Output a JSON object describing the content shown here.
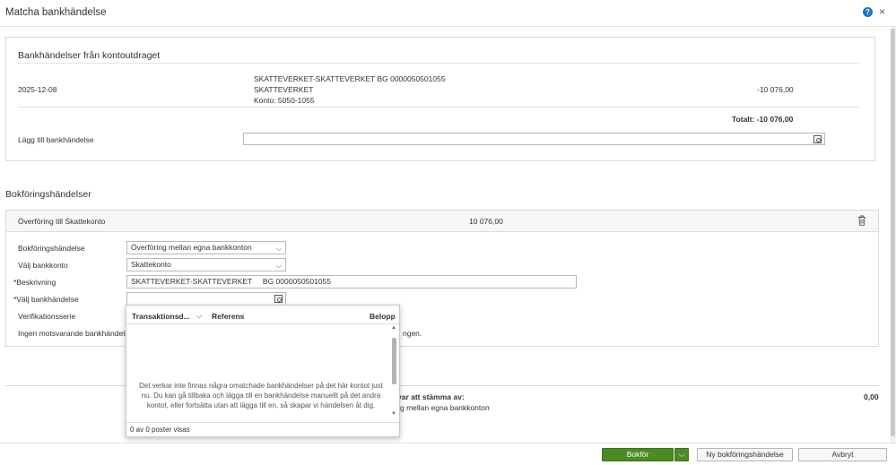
{
  "dialog": {
    "title": "Matcha bankhändelse",
    "help_glyph": "?",
    "close_glyph": "×"
  },
  "bank_events": {
    "heading": "Bankhändelser från kontoutdraget",
    "date": "2025-12-08",
    "desc_line1": "SKATTEVERKET-SKATTEVERKET BG 0000050501055",
    "desc_line2": "SKATTEVERKET",
    "desc_line3": "Konto: 5050-1055",
    "amount": "-10 076,00",
    "total": "Totalt: -10 076,00",
    "add_label": "Lägg till bankhändelse"
  },
  "booking": {
    "section_title": "Bokföringshändelser",
    "row_title": "Överföring till Skattekonto",
    "row_amount": "10 076,00",
    "fields": {
      "event_label": "Bokföringshändelse",
      "event_value": "Överföring mellan egna bankkonton",
      "account_label": "Välj bankkonto",
      "account_value": "Skattekonto",
      "description_label": "Beskrivning",
      "description_value": "SKATTEVERKET-SKATTEVERKET     BG 0000050501055",
      "bank_event_label": "Välj bankhändelse",
      "series_label": "Verifikationsserie",
      "no_match_prefix": "Ingen motsvarande bankhändels",
      "no_match_suffix": "ngen."
    },
    "required_marker": "*"
  },
  "dropdown": {
    "col_date": "Transaktionsd...",
    "col_ref": "Referens",
    "col_amount": "Belopp",
    "empty_text": "Det verkar inte finnas några omatchade bankhändelser på det här kontot just nu. Du kan gå tillbaka och lägga till en bankhändelse manuellt på det andra kontot, eller fortsätta utan att lägga till en, så skapar vi händelsen åt dig.",
    "footer": "0 av 0 poster visas"
  },
  "summary": {
    "remaining_label": "var att stämma av:",
    "remaining_value": "0,00",
    "subtext": "g mellan egna bankkonton"
  },
  "footer": {
    "book_label": "Bokför",
    "new_event_label": "Ny bokföringshändelse",
    "cancel_label": "Avbryt"
  },
  "colors": {
    "primary": "#4c8a24",
    "help": "#1d73c9"
  }
}
